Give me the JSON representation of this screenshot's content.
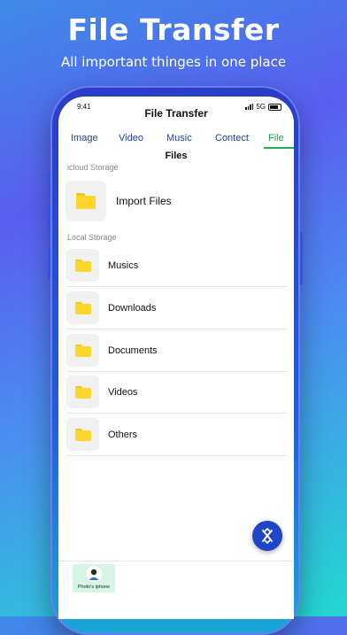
{
  "promo": {
    "headline": "File Transfer",
    "subline": "All important thinges in one place"
  },
  "status_bar": {
    "time": "9:41",
    "network": "5G"
  },
  "app": {
    "title": "File Transfer",
    "tabs": [
      {
        "label": "Image",
        "active": false
      },
      {
        "label": "Video",
        "active": false
      },
      {
        "label": "Music",
        "active": false
      },
      {
        "label": "Contect",
        "active": false
      },
      {
        "label": "File",
        "active": true
      }
    ],
    "section_title": "Files",
    "icloud": {
      "label": "icloud Storage",
      "import_label": "Import Files",
      "icon": "folder-icon"
    },
    "local": {
      "label": "Local Storage",
      "items": [
        {
          "label": "Musics",
          "icon": "folder-icon"
        },
        {
          "label": "Downloads",
          "icon": "folder-icon"
        },
        {
          "label": "Documents",
          "icon": "folder-icon"
        },
        {
          "label": "Videos",
          "icon": "folder-icon"
        },
        {
          "label": "Others",
          "icon": "folder-icon"
        }
      ]
    },
    "fab_icon": "transfer-icon",
    "device": {
      "label": "Photo's iphone",
      "icon": "avatar-icon"
    }
  },
  "colors": {
    "tab_text": "#2240a8",
    "tab_active": "#1aa63c",
    "folder": "#fcd62c",
    "fab": "#1f45c8",
    "device_card": "#d6f5e6"
  }
}
